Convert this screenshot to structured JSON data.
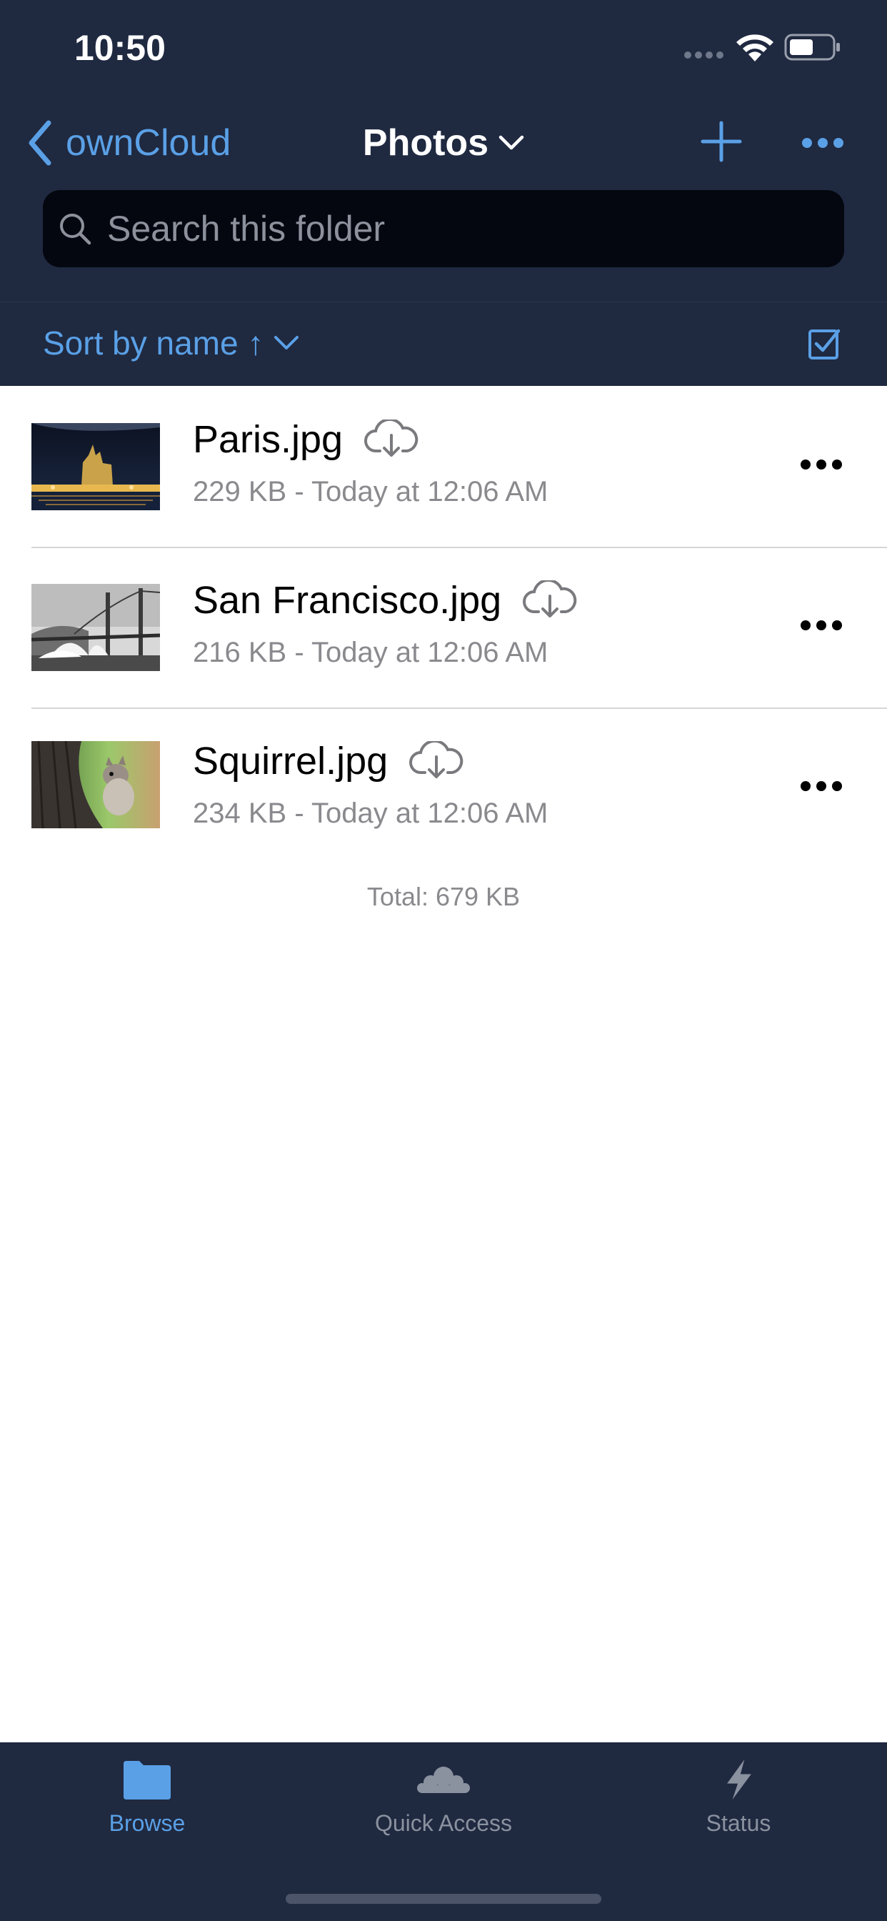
{
  "status_bar": {
    "time": "10:50"
  },
  "navbar": {
    "back_label": "ownCloud",
    "title": "Photos"
  },
  "search": {
    "placeholder": "Search this folder"
  },
  "sort": {
    "label": "Sort by name ↑"
  },
  "files": [
    {
      "name": "Paris.jpg",
      "meta": "229 KB - Today at 12:06 AM"
    },
    {
      "name": "San Francisco.jpg",
      "meta": "216 KB - Today at 12:06 AM"
    },
    {
      "name": "Squirrel.jpg",
      "meta": "234 KB - Today at 12:06 AM"
    }
  ],
  "total": "Total: 679 KB",
  "tabs": [
    {
      "label": "Browse",
      "icon": "folder-icon",
      "active": true
    },
    {
      "label": "Quick Access",
      "icon": "cloud-icon",
      "active": false
    },
    {
      "label": "Status",
      "icon": "bolt-icon",
      "active": false
    }
  ],
  "colors": {
    "header_bg": "#1f2940",
    "accent": "#5aa0e6",
    "search_bg": "#04070f"
  }
}
